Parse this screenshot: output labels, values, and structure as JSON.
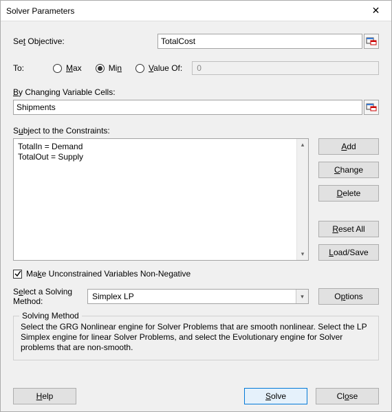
{
  "window": {
    "title": "Solver Parameters"
  },
  "labels": {
    "set_objective_pre": "Se",
    "set_objective_hot": "t",
    "set_objective_post": " Objective:",
    "to": "To:",
    "max_hot": "M",
    "max_post": "ax",
    "min_pre": "Mi",
    "min_hot": "n",
    "valueof_hot": "V",
    "valueof_post": "alue Of:",
    "changing_hot": "B",
    "changing_post": "y Changing Variable Cells:",
    "subject_pre": "S",
    "subject_hot": "u",
    "subject_post": "bject to the Constraints:",
    "make_unconstrained_pre": "Ma",
    "make_unconstrained_hot": "k",
    "make_unconstrained_post": "e Unconstrained Variables Non-Negative",
    "select_pre": "S",
    "select_hot": "e",
    "select_post1": "lect a Solving",
    "select_post2": "Method:",
    "solving_method_legend": "Solving Method",
    "solving_method_desc": "Select the GRG Nonlinear engine for Solver Problems that are smooth nonlinear. Select the LP Simplex engine for linear Solver Problems, and select the Evolutionary engine for Solver problems that are non-smooth."
  },
  "values": {
    "objective": "TotalCost",
    "value_of": "0",
    "changing_cells": "Shipments",
    "constraints": [
      "TotalIn = Demand",
      "TotalOut = Supply"
    ],
    "solving_method": "Simplex LP",
    "to_selected": "Min",
    "make_unconstrained_checked": true
  },
  "buttons": {
    "add_hot": "A",
    "add_post": "dd",
    "change_hot": "C",
    "change_post": "hange",
    "delete_hot": "D",
    "delete_post": "elete",
    "reset_hot": "R",
    "reset_post": "eset All",
    "loadsave_hot": "L",
    "loadsave_post": "oad/Save",
    "options_pre": "O",
    "options_hot": "p",
    "options_post": "tions",
    "help_hot": "H",
    "help_post": "elp",
    "solve_hot": "S",
    "solve_post": "olve",
    "close_pre": "Cl",
    "close_hot": "o",
    "close_post": "se"
  }
}
